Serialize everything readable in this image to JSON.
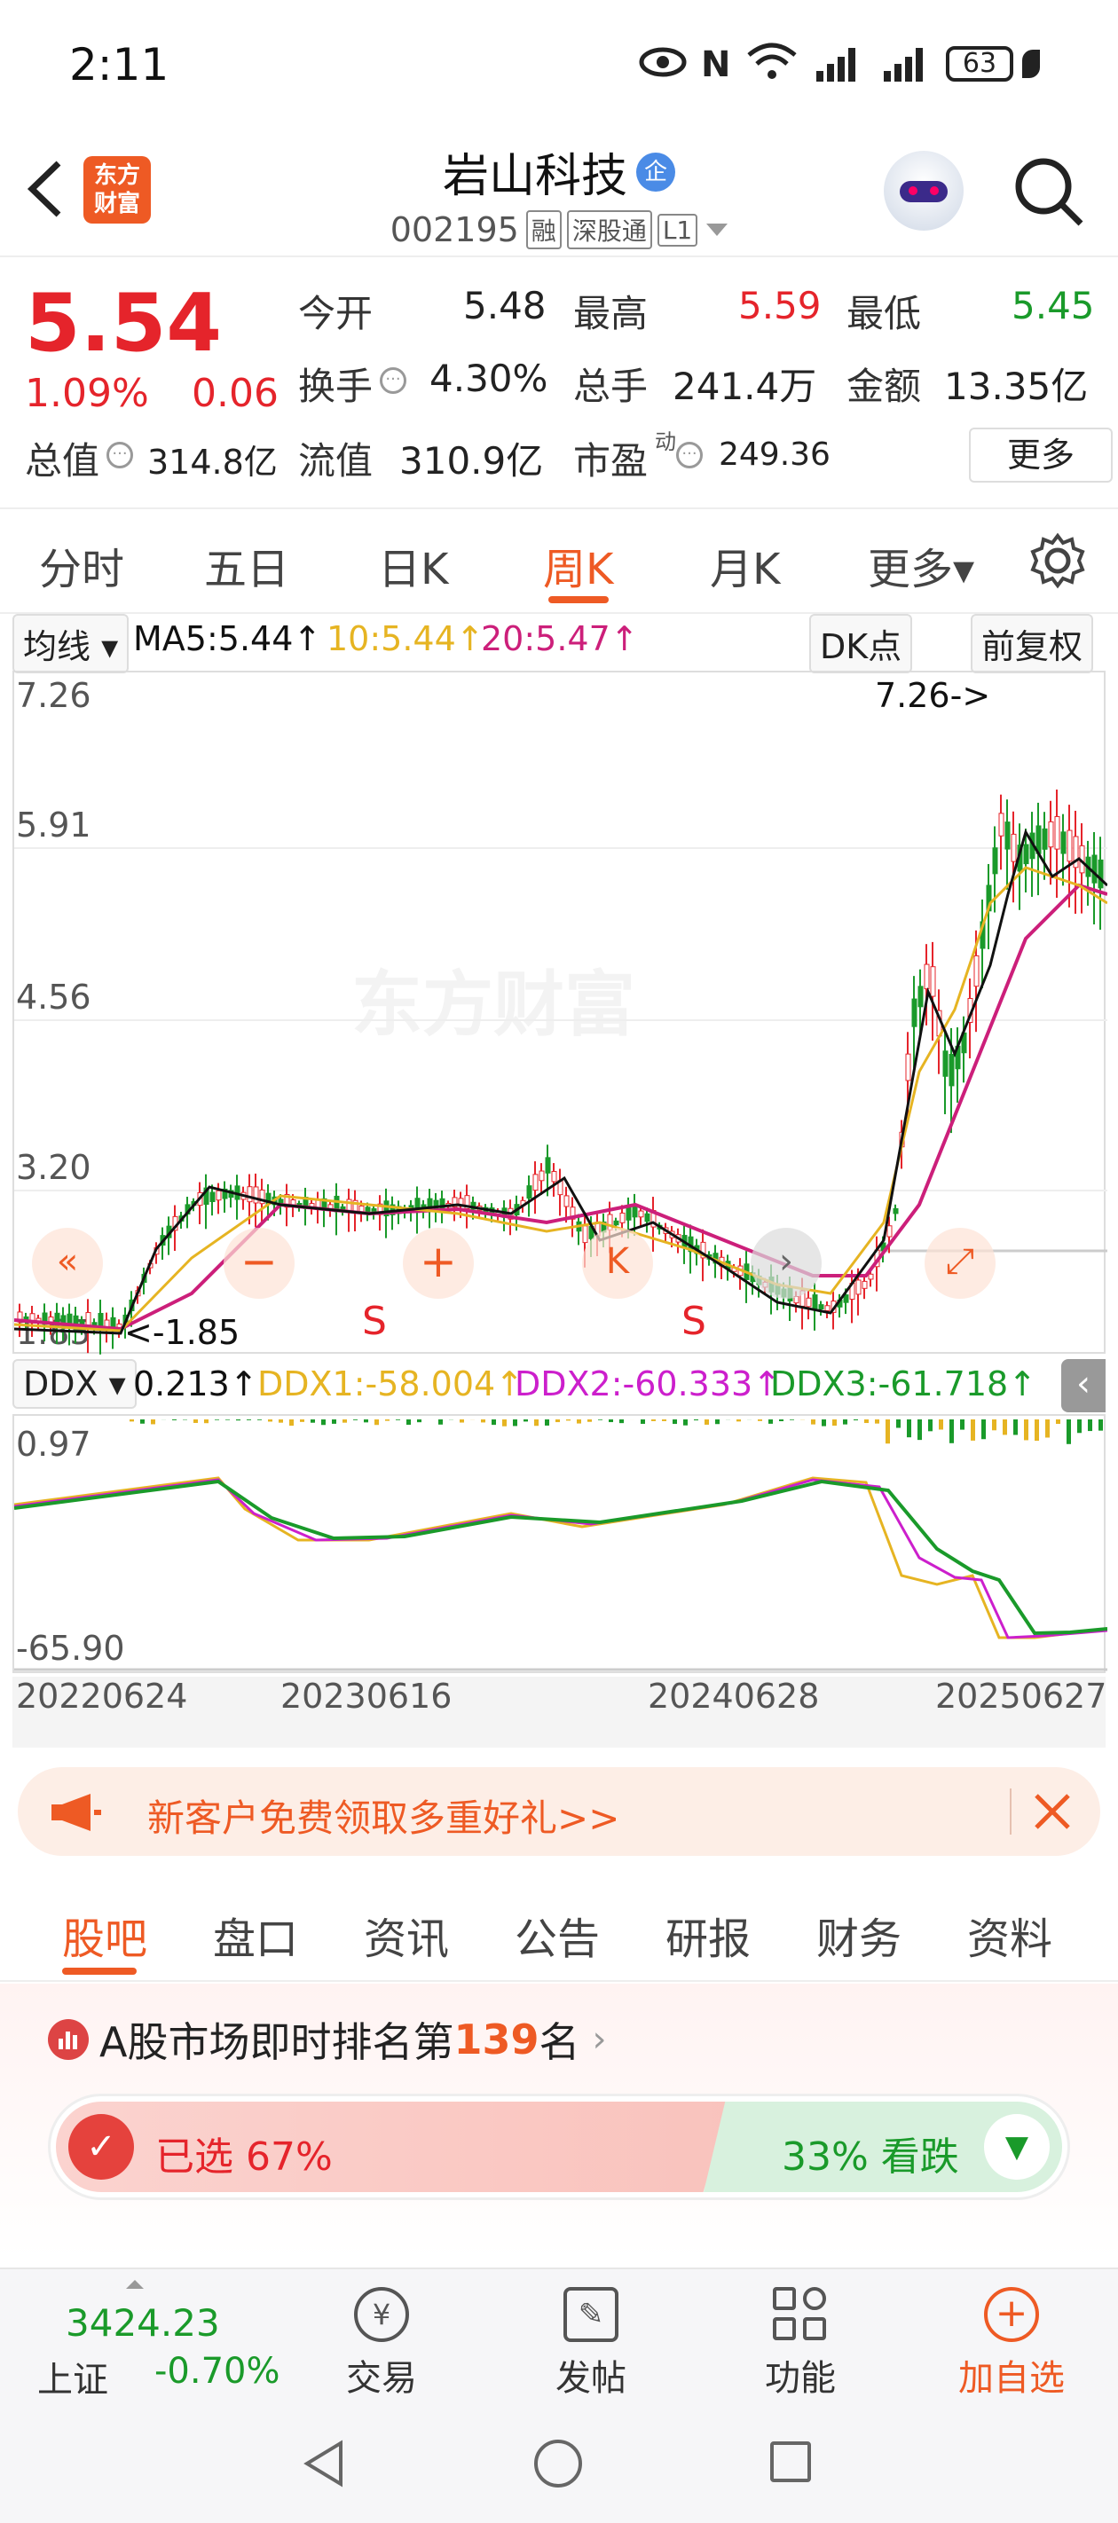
{
  "status_bar": {
    "time": "2:11",
    "battery": "63"
  },
  "header": {
    "title": "岩山科技",
    "title_badge": "企",
    "code": "002195",
    "tags": [
      "融",
      "深股通",
      "L1"
    ],
    "logo_text_line1": "东方",
    "logo_text_line2": "财富"
  },
  "quote": {
    "price": "5.54",
    "change_pct": "1.09%",
    "change_abs": "0.06",
    "fields": [
      {
        "label": "今开",
        "value": "5.48"
      },
      {
        "label": "最高",
        "value": "5.59"
      },
      {
        "label": "最低",
        "value": "5.45"
      },
      {
        "label": "换手",
        "value": "4.30%"
      },
      {
        "label": "总手",
        "value": "241.4万"
      },
      {
        "label": "金额",
        "value": "13.35亿"
      }
    ],
    "total_value_label": "总值",
    "total_value": "314.8亿",
    "float_value_label": "流值",
    "float_value": "310.9亿",
    "pe_label": "市盈",
    "pe_sup": "动",
    "pe_value": "249.36",
    "more_button": "更多"
  },
  "chart_tabs": {
    "items": [
      "分时",
      "五日",
      "日K",
      "周K",
      "月K",
      "更多▾"
    ],
    "active": "周K"
  },
  "ma_bar": {
    "selector": "均线",
    "ma5": "MA5:5.44↑",
    "ma10": "10:5.44↑",
    "ma20": "20:5.47↑",
    "dk_button": "DK点",
    "adjust_button": "前复权"
  },
  "kline": {
    "y_labels": [
      "7.26",
      "5.91",
      "4.56",
      "3.20",
      "1.85"
    ],
    "high_annotation": "7.26->",
    "low_annotation": "<-1.85",
    "watermark": "东方财富",
    "signals": [
      "S",
      "S"
    ],
    "signal_color": "#e5242b",
    "ma5_color": "#111111",
    "ma10_color": "#e6b422",
    "ma20_color": "#cc1f7a"
  },
  "ddx_bar": {
    "selector": "DDX",
    "ddx": "0.213↑",
    "ddx1": "DDX1:-58.004↑",
    "ddx2": "DDX2:-60.333↑",
    "ddx3": "DDX3:-61.718↑"
  },
  "ddx_chart": {
    "y_top": "0.97",
    "y_bottom": "-65.90",
    "x_labels": [
      "20220624",
      "20230616",
      "20240628",
      "20250627"
    ]
  },
  "promo": {
    "text": "新客户免费领取多重好礼>>"
  },
  "sub_tabs": {
    "items": [
      "股吧",
      "盘口",
      "资讯",
      "公告",
      "研报",
      "财务",
      "资料"
    ],
    "active": "股吧"
  },
  "rank": {
    "prefix": "A股市场即时排名第",
    "number": "139",
    "suffix": "名",
    "bull_label": "已选 67%",
    "bear_label": "33% 看跌"
  },
  "bottom_nav": {
    "index_value": "3424.23",
    "index_name": "上证",
    "index_change": "-0.70%",
    "items": [
      "交易",
      "发帖",
      "功能",
      "加自选"
    ]
  }
}
